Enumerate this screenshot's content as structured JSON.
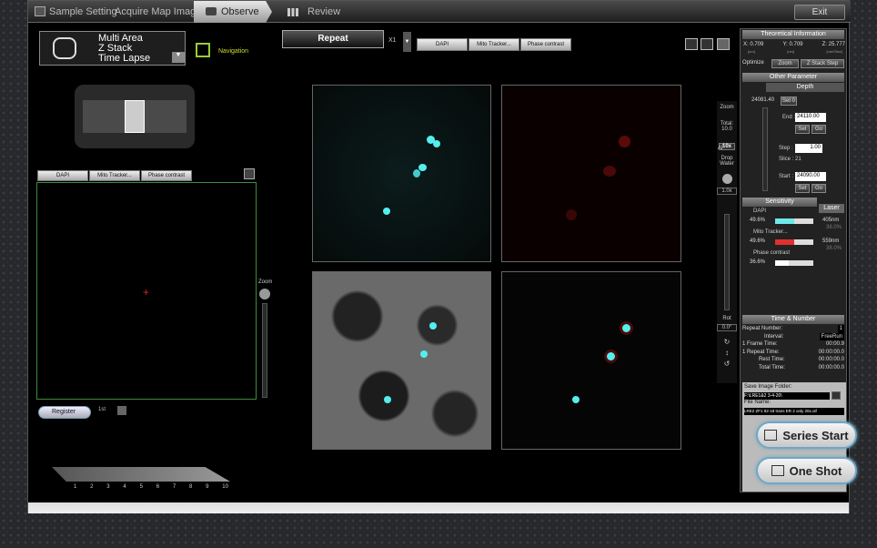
{
  "topbar": {
    "tabs": [
      "Sample Setting",
      "Acquire Map Image",
      "Observe",
      "Review"
    ],
    "exit": "Exit"
  },
  "mode": {
    "lines": [
      "Multi Area",
      "Z Stack",
      "Time Lapse"
    ],
    "navigation": "Navigation"
  },
  "repeat": {
    "label": "Repeat",
    "x": "X1"
  },
  "channels": [
    "DAPI",
    "Mito Tracker...",
    "Phase contrast"
  ],
  "left": {
    "register": "Register",
    "first": "1st",
    "zoom": "Zoom",
    "scale": [
      "1",
      "2",
      "3",
      "4",
      "5",
      "6",
      "7",
      "8",
      "9",
      "10"
    ]
  },
  "zoomcol": {
    "zoom": "Zoom",
    "total": "Total:",
    "total_val": "10.0",
    "mag": "10x",
    "af": "AF",
    "drop": "Drop",
    "water": "Water",
    "val": "1.0x",
    "rot": "Rot",
    "rot_val": "0.0°"
  },
  "theo": {
    "title": "Theoretical Information",
    "x": "X: 0.709",
    "y": "Y: 0.709",
    "z": "Z: 25.777",
    "ux": "[um]",
    "uy": "[um]",
    "uz": "[um/Slice]",
    "optimize": "Optimize",
    "zoom": "Zoom",
    "zstep": "Z Stack Step"
  },
  "other": {
    "title": "Other Parameter",
    "depth": "Depth",
    "cur": "24081.40",
    "set0": "Set 0",
    "end_label": "End :",
    "end": "24110.00",
    "set": "Set",
    "go": "Go",
    "step_label": "Step :",
    "step": "1.00",
    "slice": "Slice : 21",
    "start_label": "Start :",
    "start": "24090.00"
  },
  "sens": {
    "title": "Sensitivity",
    "laser": "Laser",
    "ch": [
      {
        "name": "DAPI",
        "pct": "49.6%",
        "nm": "405nm",
        "sub": "38.0%",
        "color": "#6ee8e8"
      },
      {
        "name": "Mito Tracker...",
        "pct": "49.6%",
        "nm": "559nm",
        "sub": "38.0%",
        "color": "#e03030"
      },
      {
        "name": "Phase contrast",
        "pct": "36.6%",
        "nm": "",
        "sub": "",
        "color": "#ffffff"
      }
    ]
  },
  "time": {
    "title": "Time & Number",
    "repeat_label": "Repeat Number:",
    "repeat": "1",
    "interval_label": "Interval:",
    "interval": "FreeRun",
    "frame_label": "1 Frame Time:",
    "frame": "00:00.9",
    "rtime_label": "1 Repeat Time:",
    "rtime": "00:00:00.0",
    "rest_label": "Rest Time:",
    "rest": "00:00:00.0",
    "total_label": "Total Time:",
    "total": "00:00:00.0"
  },
  "save": {
    "folder_label": "Save Image Folder:",
    "folder": "F:\\LRE1&2 3-4-20\\",
    "file_label": "File Name:",
    "file": "LRE2 ZF1 82-18 trans ER 2 only 20x.oif"
  },
  "actions": {
    "series": "Series Start",
    "oneshot": "One Shot"
  }
}
